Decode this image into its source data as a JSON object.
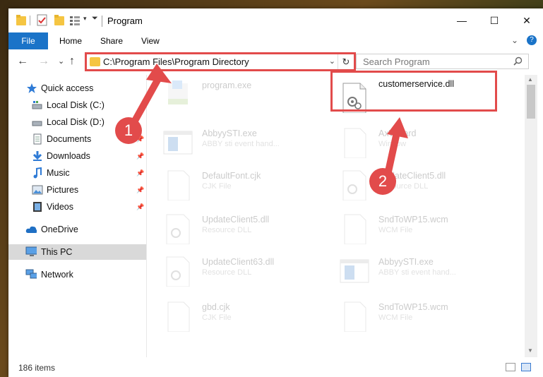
{
  "window": {
    "title": "Program",
    "controls": {
      "minimize": "—",
      "maximize": "☐",
      "close": "✕"
    }
  },
  "ribbon": {
    "tabs": [
      "File",
      "Home",
      "Share",
      "View"
    ],
    "expand": "⌄",
    "help": "?"
  },
  "address_bar": {
    "path": "C:\\Program Files\\Program Directory",
    "dropdown": "⌄",
    "refresh": "↻"
  },
  "search": {
    "placeholder": "Search Program"
  },
  "nav": {
    "back": "←",
    "forward": "→",
    "recent": "⌄",
    "up": "↑",
    "items": [
      {
        "label": "Quick access",
        "icon": "star-icon"
      },
      {
        "label": "Local Disk (C:)",
        "icon": "drive-icon"
      },
      {
        "label": "Local Disk (D:)",
        "icon": "drive-icon"
      },
      {
        "label": "Documents",
        "icon": "documents-icon"
      },
      {
        "label": "Downloads",
        "icon": "download-icon"
      },
      {
        "label": "Music",
        "icon": "music-icon"
      },
      {
        "label": "Pictures",
        "icon": "pictures-icon"
      },
      {
        "label": "Videos",
        "icon": "videos-icon"
      },
      {
        "label": "OneDrive",
        "icon": "cloud-icon"
      },
      {
        "label": "This PC",
        "icon": "computer-icon"
      },
      {
        "label": "Network",
        "icon": "network-icon"
      }
    ]
  },
  "files": [
    {
      "name": "program.exe",
      "type": "",
      "icon": "installer-icon",
      "faded": true
    },
    {
      "name": "customerservice.dll",
      "type": "",
      "icon": "dll-gear-icon",
      "faded": false
    },
    {
      "name": "AbbyySTI.exe",
      "type": "ABBY sti event hand...",
      "icon": "app-window-icon",
      "faded": true
    },
    {
      "name": "AxWizard",
      "type": "Window",
      "icon": "blank-file-icon",
      "faded": true
    },
    {
      "name": "DefaultFont.cjk",
      "type": "CJK File",
      "icon": "blank-file-icon",
      "faded": true
    },
    {
      "name": "UpdateClient5.dll",
      "type": "Resource DLL",
      "icon": "dll-gear-icon",
      "faded": true
    },
    {
      "name": "UpdateClient5.dll",
      "type": "Resource DLL",
      "icon": "dll-gear-icon",
      "faded": true
    },
    {
      "name": "SndToWP15.wcm",
      "type": "WCM File",
      "icon": "blank-file-icon",
      "faded": true
    },
    {
      "name": "UpdateClient63.dll",
      "type": "Resource DLL",
      "icon": "dll-gear-icon",
      "faded": true
    },
    {
      "name": "AbbyySTI.exe",
      "type": "ABBY sti event hand...",
      "icon": "app-window-icon",
      "faded": true
    },
    {
      "name": "gbd.cjk",
      "type": "CJK File",
      "icon": "blank-file-icon",
      "faded": true
    },
    {
      "name": "SndToWP15.wcm",
      "type": "WCM File",
      "icon": "blank-file-icon",
      "faded": true
    }
  ],
  "status": {
    "count": "186 items"
  },
  "callouts": {
    "step1": "1",
    "step2": "2"
  },
  "colors": {
    "accent": "#1a73c8",
    "highlight": "#e24b4b"
  }
}
